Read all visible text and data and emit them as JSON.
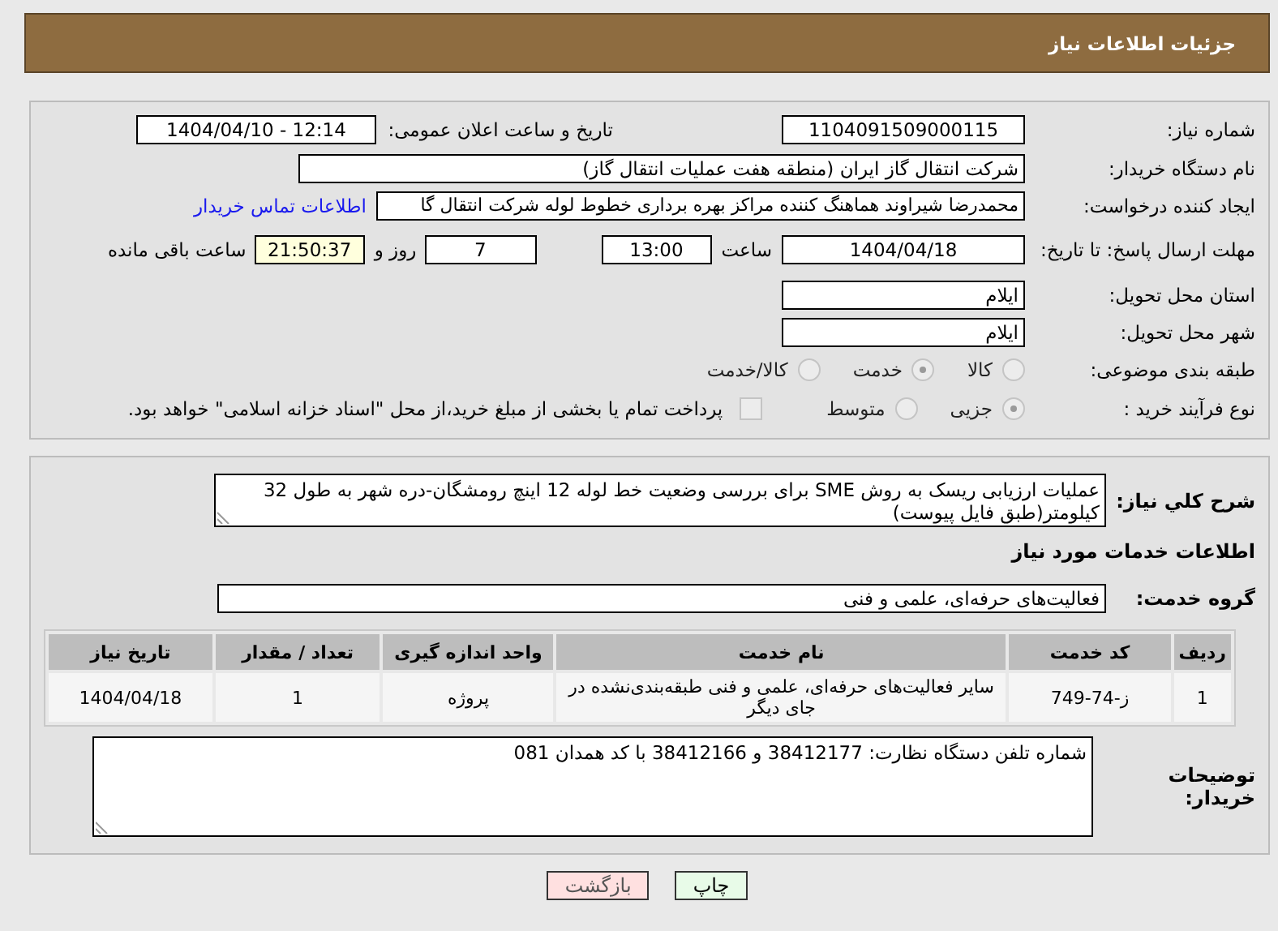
{
  "header": {
    "title": "جزئیات اطلاعات نیاز"
  },
  "need_number": {
    "label": "شماره نیاز:",
    "value": "1104091509000115"
  },
  "announce": {
    "label": "تاریخ و ساعت اعلان عمومی:",
    "value": "1404/04/10 - 12:14"
  },
  "buyer": {
    "label": "نام دستگاه خریدار:",
    "value": "شرکت انتقال گاز ایران (منطقه هفت عملیات انتقال گاز)"
  },
  "creator": {
    "label": "ایجاد کننده درخواست:",
    "value": "محمدرضا شیراوند هماهنگ کننده مراکز بهره برداری خطوط لوله  شرکت انتقال گا",
    "link": "اطلاعات تماس خریدار"
  },
  "deadline": {
    "label": "مهلت ارسال پاسخ: تا تاریخ:",
    "date": "1404/04/18",
    "time_label": "ساعت",
    "time": "13:00",
    "days": "7",
    "days_label": "روز و",
    "remaining": "21:50:37",
    "remaining_label": "ساعت باقی مانده"
  },
  "province": {
    "label": "استان محل تحویل:",
    "value": "ایلام"
  },
  "city": {
    "label": "شهر محل تحویل:",
    "value": "ایلام"
  },
  "category": {
    "label": "طبقه بندی موضوعی:",
    "options": [
      {
        "label": "کالا",
        "selected": false
      },
      {
        "label": "خدمت",
        "selected": true
      },
      {
        "label": "کالا/خدمت",
        "selected": false
      }
    ]
  },
  "purchase": {
    "label": "نوع فرآیند خرید :",
    "options": [
      {
        "label": "جزیی",
        "selected": true
      },
      {
        "label": "متوسط",
        "selected": false
      }
    ],
    "payment": {
      "checked": false,
      "text": "پرداخت تمام یا بخشی از مبلغ خرید،از محل \"اسناد خزانه اسلامی\" خواهد بود."
    }
  },
  "description": {
    "label": "شرح کلي نیاز:",
    "value": "عملیات ارزیابی ریسک به روش SME برای بررسی وضعیت خط لوله 12 اینچ رومشگان-دره شهر به طول 32 کیلومتر(طبق فایل پیوست)"
  },
  "services_title": "اطلاعات خدمات مورد نیاز",
  "service_group": {
    "label": "گروه خدمت:",
    "value": "فعالیت‌های حرفه‌ای، علمی و فنی"
  },
  "table": {
    "columns": [
      "ردیف",
      "کد خدمت",
      "نام خدمت",
      "واحد اندازه گیری",
      "تعداد / مقدار",
      "تاریخ نیاز"
    ],
    "rows": [
      [
        "1",
        "ز-74-749",
        "سایر فعالیت‌های حرفه‌ای، علمی و فنی طبقه‌بندی‌نشده در جای دیگر",
        "پروژه",
        "1",
        "1404/04/18"
      ]
    ]
  },
  "buyer_notes": {
    "label": "توضیحات خریدار:",
    "value": "شماره تلفن دستگاه نظارت: 38412177 و 38412166 با کد همدان 081"
  },
  "buttons": [
    {
      "label": "چاپ",
      "kind": "print"
    },
    {
      "label": "بازگشت",
      "kind": "back"
    }
  ]
}
